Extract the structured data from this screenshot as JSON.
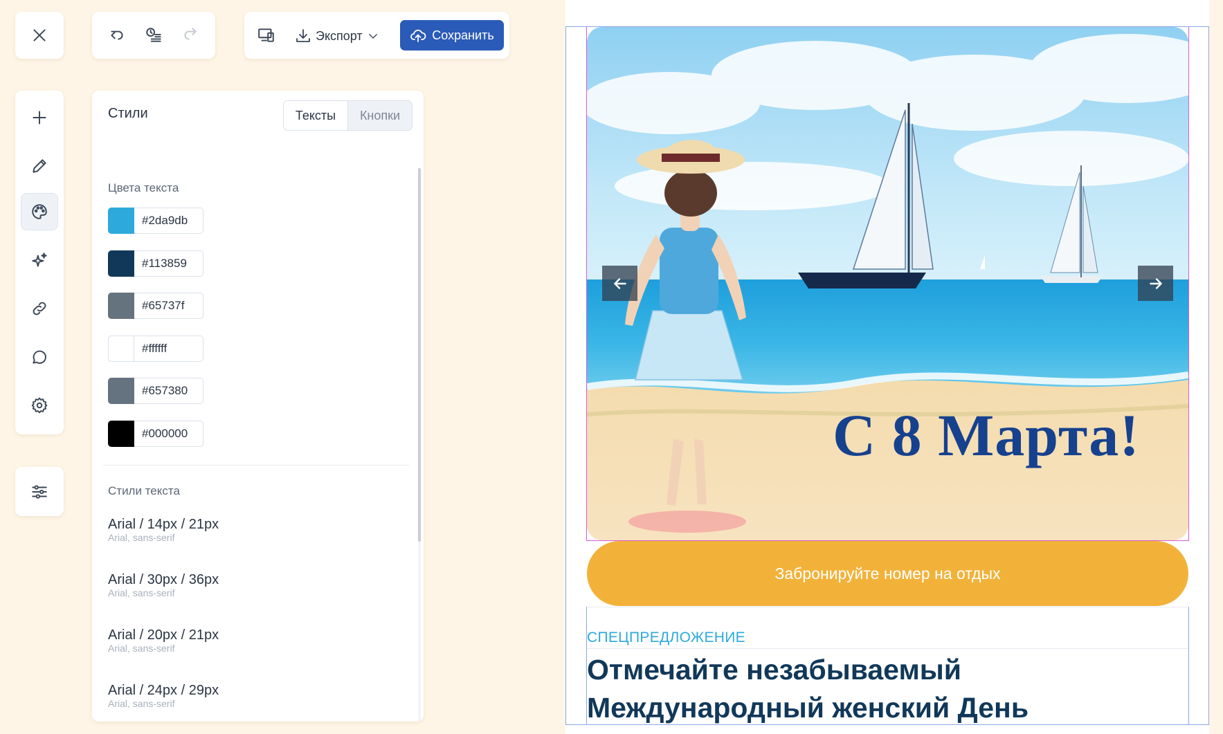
{
  "toolbar": {
    "close_icon": "close-icon",
    "undo_icon": "undo-icon",
    "history_icon": "history-icon",
    "redo_icon": "redo-icon",
    "preview_icon": "devices-icon",
    "export_label": "Экспорт",
    "save_label": "Сохранить",
    "accent_color": "#2b5bb8"
  },
  "rail": {
    "items": [
      {
        "icon": "plus-icon"
      },
      {
        "icon": "pencil-icon"
      },
      {
        "icon": "palette-icon",
        "active": true
      },
      {
        "icon": "sparkles-icon"
      },
      {
        "icon": "link-icon"
      },
      {
        "icon": "chat-icon"
      },
      {
        "icon": "gear-icon"
      }
    ],
    "bottom_icon": "sliders-icon"
  },
  "styles_panel": {
    "title": "Стили",
    "tabs": [
      {
        "label": "Тексты",
        "active": true
      },
      {
        "label": "Кнопки",
        "active": false
      }
    ],
    "colors_label": "Цвета текста",
    "colors": [
      "#2da9db",
      "#113859",
      "#65737f",
      "#ffffff",
      "#657380",
      "#000000"
    ],
    "text_styles_label": "Стили текста",
    "text_styles": [
      {
        "name": "Arial / 14px / 21px",
        "family": "Arial, sans-serif"
      },
      {
        "name": "Arial / 30px / 36px",
        "family": "Arial, sans-serif"
      },
      {
        "name": "Arial / 20px / 21px",
        "family": "Arial, sans-serif"
      },
      {
        "name": "Arial / 24px / 29px",
        "family": "Arial, sans-serif"
      }
    ]
  },
  "preview": {
    "hero_title": "С 8 Марта!",
    "prev_icon": "arrow-left-icon",
    "next_icon": "arrow-right-icon",
    "cta_label": "Забронируйте номер на отдых",
    "cta_color": "#f2b23a",
    "kicker": "СПЕЦПРЕДЛОЖЕНИЕ",
    "headline": "Отмечайте незабываемый Международный женский День"
  }
}
